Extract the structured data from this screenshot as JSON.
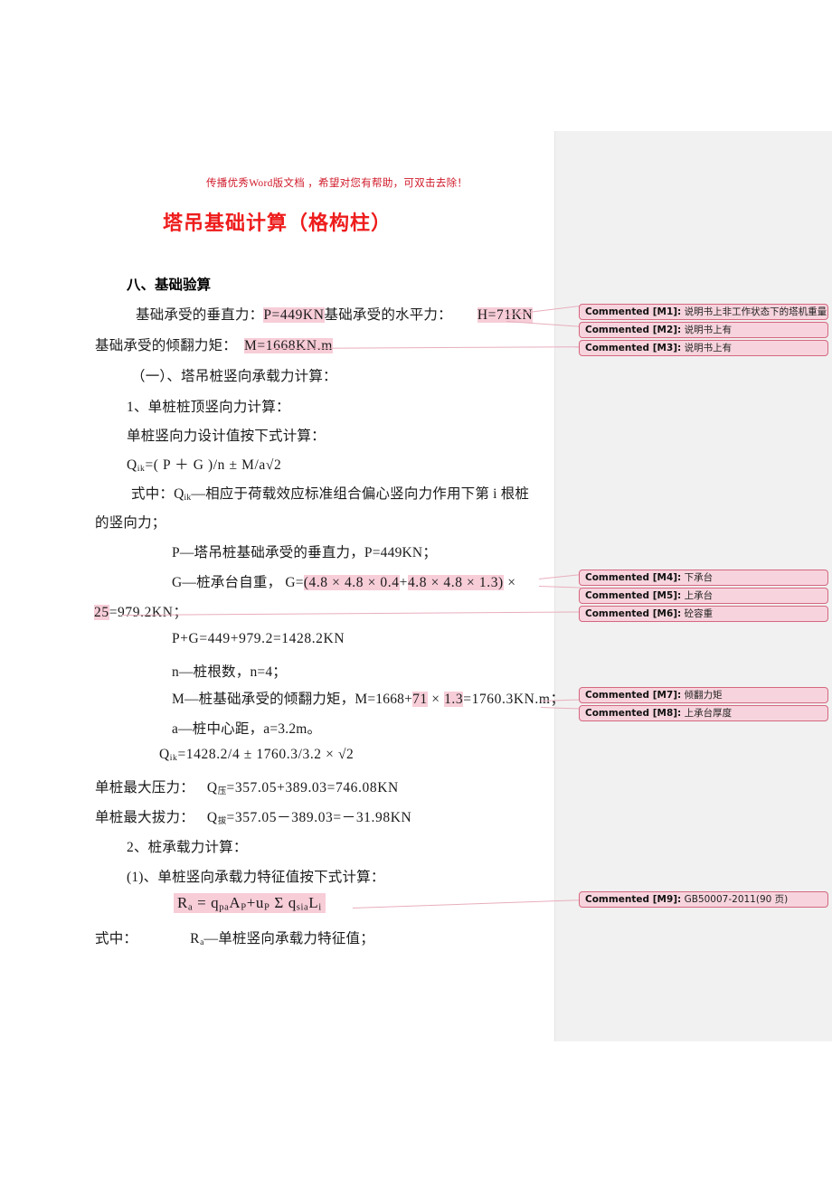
{
  "document": {
    "watermark": "传播优秀Word版文档 ，希望对您有帮助，可双击去除！",
    "title": "塔吊基础计算（格构柱）",
    "section_heading": "八、基础验算",
    "lines": {
      "l1_a": "基础承受的垂直力：",
      "l1_hl1": "P=449KN",
      "l1_b": "基础承受的水平力：",
      "l1_hl2": "H=71KN",
      "l2_a": "基础承受的倾翻力矩：",
      "l2_hl": "M=1668KN.m",
      "l3": "（一）、塔吊桩竖向承载力计算：",
      "l4": "1、单桩桩顶竖向力计算：",
      "l5": "单桩竖向力设计值按下式计算：",
      "l6_q": "Q",
      "l6_sub": "ik",
      "l6_rest": "=( P ＋ G )/n ± M/a",
      "l6_sqrt": "√2",
      "l7_a": "式中：Q",
      "l7_sub": "ik",
      "l7_b": "—相应于荷载效应标准组合偏心竖向力作用下第 i 根桩",
      "l8": "的竖向力；",
      "l9": "P—塔吊桩基础承受的垂直力，P=449KN；",
      "l10_a": "G—桩承台自重， G=",
      "l10_hl_open": "(4.8 × 4.8 × 0.4",
      "l10_plus": "+",
      "l10_hl_close": "4.8 × 4.8 × 1.3)",
      "l10_tail": " ×",
      "l11_hl": "25",
      "l11_tail": "=979.2KN；",
      "l12": "P+G=449+979.2=1428.2KN",
      "l13": "n—桩根数，n=4；",
      "l14_a": "M—桩基础承受的倾翻力矩，M=1668+",
      "l14_hl1": "71",
      "l14_mid": " × ",
      "l14_hl2": "1.3",
      "l14_b": "=1760.3KN.m；",
      "l15": "a—桩中心距，a=3.2m。",
      "l16_q": "Q",
      "l16_sub": "ik",
      "l16_rest": "=1428.2/4 ± 1760.3/3.2 × ",
      "l16_sqrt": "√2",
      "l17_a": "单桩最大压力：",
      "l17_q": "Q",
      "l17_sub": "压",
      "l17_b": "=357.05+389.03=746.08KN",
      "l18_a": "单桩最大拔力：",
      "l18_q": "Q",
      "l18_sub": "拔",
      "l18_b": "=357.05－389.03=－31.98KN",
      "l19": "2、桩承载力计算：",
      "l20": "(1)、单桩竖向承载力特征值按下式计算：",
      "l21_formula": "R",
      "l21_sub_a": "a",
      "l21_eq": " =  q",
      "l21_sub_pa": "pa",
      "l21_A": "A",
      "l21_sub_P": "P",
      "l21_plus": "+u",
      "l21_sub_P2": "P",
      "l21_sigma": " Σ q",
      "l21_sub_sia": "sia",
      "l21_L": "L",
      "l21_sub_i": "i",
      "l22_a": "式中：",
      "l22_r": "R",
      "l22_sub": "a",
      "l22_b": "—单桩竖向承载力特征值；"
    }
  },
  "comments": [
    {
      "id": "Commented [M1]:",
      "text": "说明书上非工作状态下的塔机重量"
    },
    {
      "id": "Commented [M2]:",
      "text": "说明书上有"
    },
    {
      "id": "Commented [M3]:",
      "text": "说明书上有"
    },
    {
      "id": "Commented [M4]:",
      "text": "下承台"
    },
    {
      "id": "Commented [M5]:",
      "text": "上承台"
    },
    {
      "id": "Commented [M6]:",
      "text": "砼容重"
    },
    {
      "id": "Commented [M7]:",
      "text": "倾翻力矩"
    },
    {
      "id": "Commented [M8]:",
      "text": "上承台厚度"
    },
    {
      "id": "Commented [M9]:",
      "text": "GB50007-2011(90 页)"
    }
  ],
  "colors": {
    "title": "#ee1c1c",
    "watermark": "#d01a2a",
    "highlight": "#f7cdd8",
    "comment_bg": "#f7d4dd",
    "comment_border": "#d4677f",
    "gutter": "#f1f1f1"
  }
}
